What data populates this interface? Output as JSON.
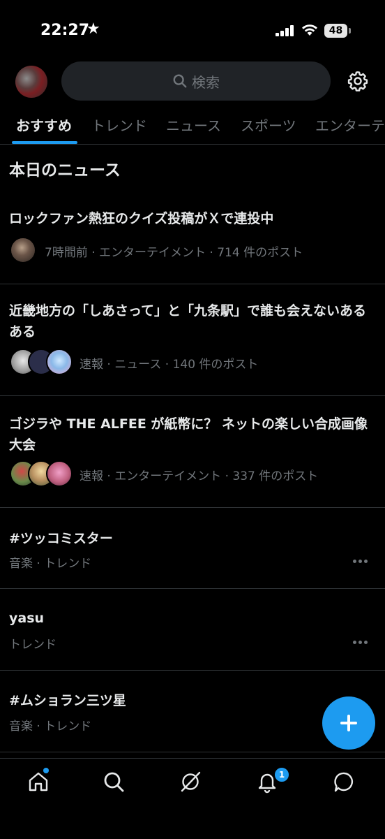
{
  "status_bar": {
    "time": "22:27",
    "star": "★",
    "battery": "48"
  },
  "header": {
    "search_placeholder": "検索"
  },
  "tabs": [
    {
      "label": "おすすめ",
      "active": true
    },
    {
      "label": "トレンド"
    },
    {
      "label": "ニュース"
    },
    {
      "label": "スポーツ"
    },
    {
      "label": "エンターテ"
    }
  ],
  "section_title": "本日のニュース",
  "news": [
    {
      "title": "ロックファン熱狂のクイズ投稿がＸで連投中",
      "meta": "7時間前 · エンターテイメント · 714 件のポスト"
    },
    {
      "title": "近畿地方の「しあさって」と「九条駅」で誰も会えないあるある",
      "meta": "速報 · ニュース · 140 件のポスト"
    },
    {
      "title": "ゴジラや THE ALFEE が紙幣に？ ネットの楽しい合成画像大会",
      "meta": "速報 · エンターテイメント · 337 件のポスト"
    }
  ],
  "trends": [
    {
      "name": "#ツッコミスター",
      "meta": "音楽 · トレンド"
    },
    {
      "name": "yasu",
      "meta": "トレンド"
    },
    {
      "name": "#ムショラン三ツ星",
      "meta": "音楽 · トレンド"
    }
  ],
  "bottom_nav": {
    "notification_count": "1"
  },
  "colors": {
    "accent": "#1d9bf0",
    "background": "#000000",
    "text": "#e7e9ea",
    "muted": "#71767b",
    "divider": "#2f3336"
  },
  "icons": [
    "star-icon",
    "signal-icon",
    "wifi-icon",
    "battery-icon",
    "search-icon",
    "gear-icon",
    "plus-icon",
    "home-icon",
    "explore-icon",
    "grok-icon",
    "bell-icon",
    "message-icon",
    "more-icon"
  ]
}
